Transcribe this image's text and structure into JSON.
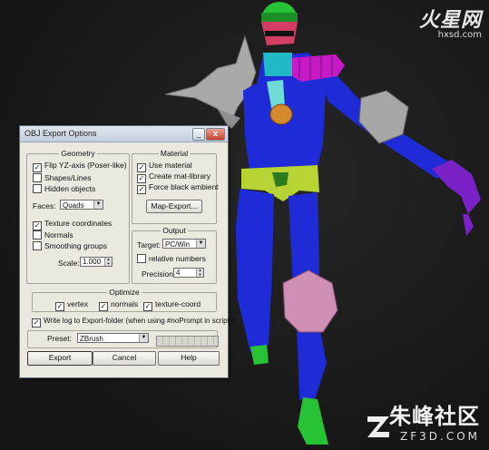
{
  "watermarks": {
    "top_brand": "火星网",
    "top_url": "hxsd.com",
    "bottom_brand": "朱峰社区",
    "bottom_url": "ZF3D.COM"
  },
  "dialog": {
    "title": "OBJ Export Options",
    "title_buttons": {
      "minimize": "_",
      "close": "x"
    },
    "geometry": {
      "title": "Geometry",
      "flip_yz": {
        "label": "Flip YZ-axis (Poser-like)",
        "checked": true
      },
      "shapes_lines": {
        "label": "Shapes/Lines",
        "checked": false
      },
      "hidden_objects": {
        "label": "Hidden objects",
        "checked": false
      },
      "faces_label": "Faces:",
      "faces_value": "Quads",
      "texture_coordinates": {
        "label": "Texture coordinates",
        "checked": true
      },
      "normals": {
        "label": "Normals",
        "checked": false
      },
      "smoothing_groups": {
        "label": "Smoothing groups",
        "checked": false
      },
      "scale_label": "Scale:",
      "scale_value": "1.000"
    },
    "material": {
      "title": "Material",
      "use_material": {
        "label": "Use material",
        "checked": true
      },
      "create_mat_library": {
        "label": "Create mat-library",
        "checked": true
      },
      "force_black_ambient": {
        "label": "Force black ambient",
        "checked": true
      },
      "map_export_label": "Map-Export..."
    },
    "output": {
      "title": "Output",
      "target_label": "Target:",
      "target_value": "PC/Win",
      "relative_numbers": {
        "label": "relative numbers",
        "checked": false
      },
      "precision_label": "Precision:",
      "precision_value": "4"
    },
    "optimize": {
      "title": "Optimize",
      "vertex": {
        "label": "vertex",
        "checked": true
      },
      "normals": {
        "label": "normals",
        "checked": true
      },
      "texture_coord": {
        "label": "texture-coord",
        "checked": true
      }
    },
    "write_log": {
      "label": "Write log to Export-folder (when using #noPrompt in scripts)",
      "checked": true
    },
    "preset_label": "Preset:",
    "preset_value": "ZBrush",
    "buttons": {
      "export": "Export",
      "cancel": "Cancel",
      "help": "Help"
    }
  },
  "colors": {
    "background": "#1c1c1c",
    "dialog_bg": "#ebe8e0",
    "body_blue": "#1f2bd6",
    "helmet_green": "#27c236",
    "cyan": "#22b9c7",
    "magenta": "#c51ac6",
    "purple": "#7a22c8",
    "pink": "#d08fb4",
    "grey": "#a7a7a7",
    "yellow_green": "#b8d334",
    "orange": "#d48a2a"
  }
}
